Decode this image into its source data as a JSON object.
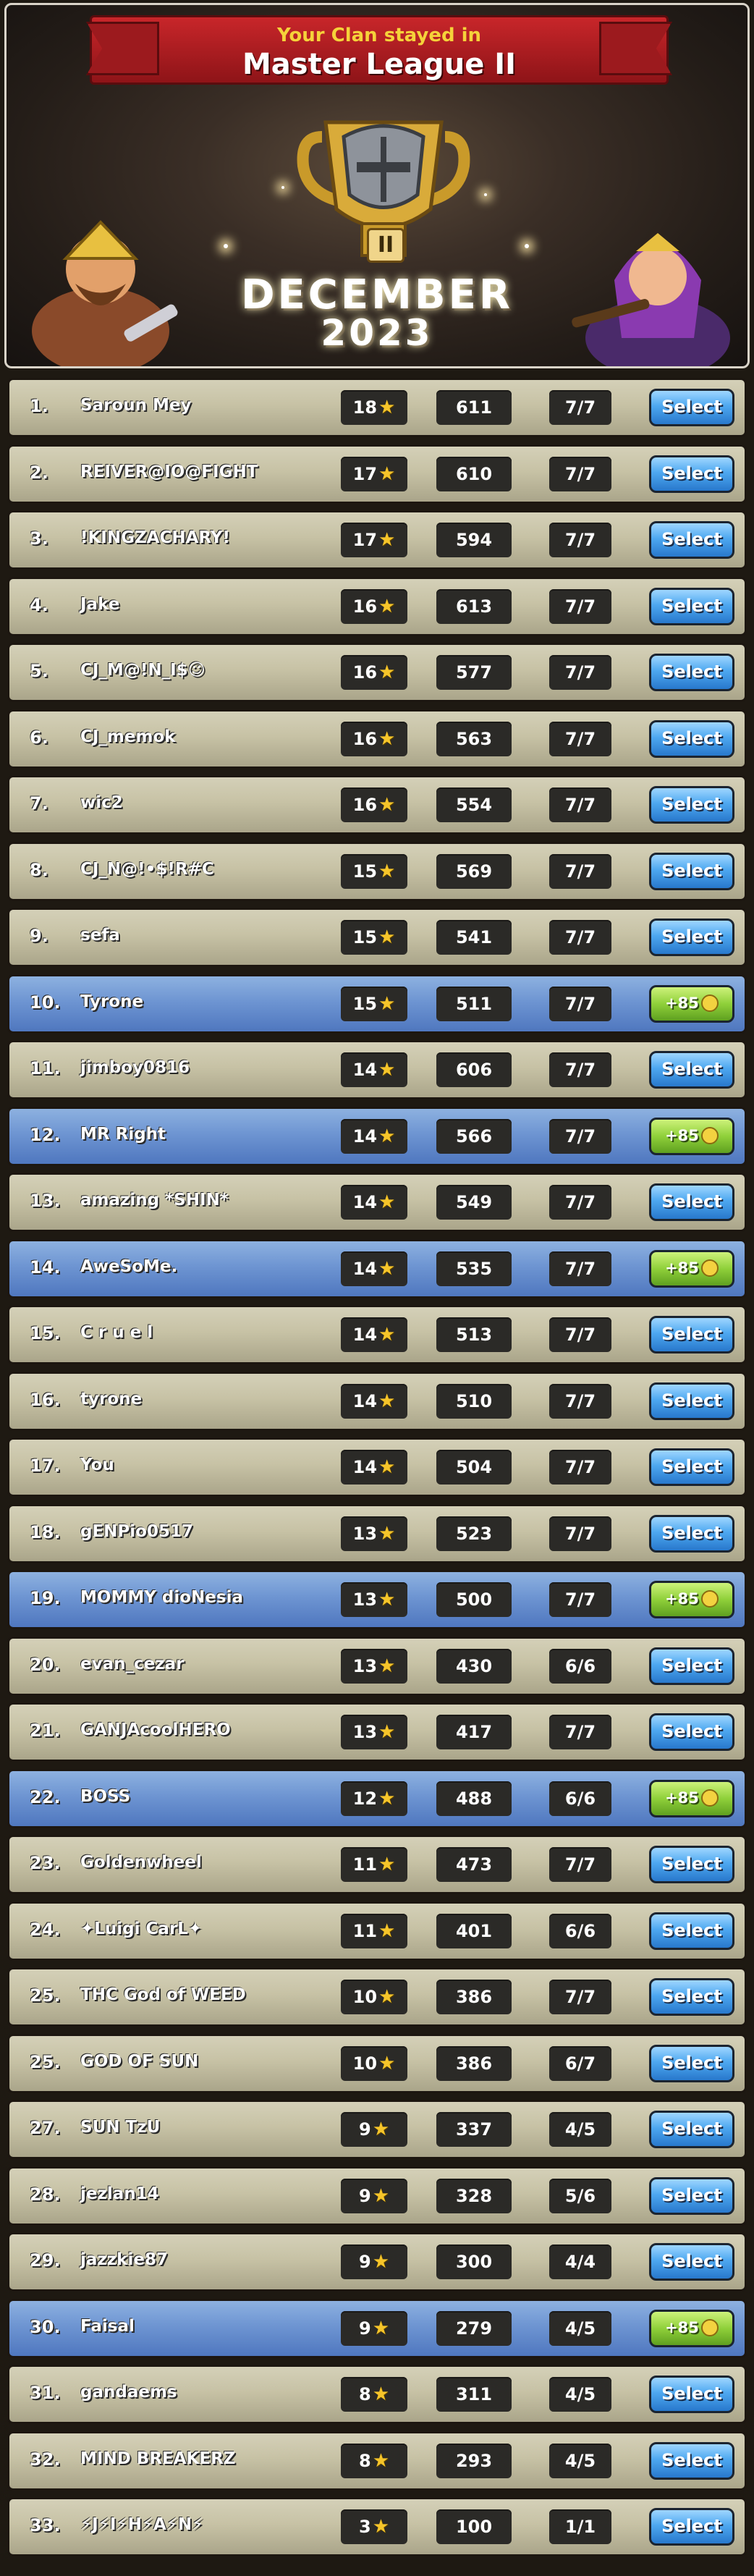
{
  "banner": {
    "subtitle": "Your Clan stayed in",
    "league": "Master League II",
    "league_badge": "II",
    "month": "DECEMBER",
    "year": "2023",
    "icons": [
      "trophy-icon",
      "barbarian-king-icon",
      "archer-queen-icon"
    ]
  },
  "colors": {
    "row_default": "#c7c2a5",
    "row_highlight": "#6e95d2",
    "select_button": "#4ea8f0",
    "bonus_button": "#8fd03a",
    "star": "#f6c52a"
  },
  "rows": [
    {
      "rank": "1.",
      "name": "Saroun Mey",
      "stars": "18",
      "score": "611",
      "attacks": "7/7",
      "action": "Select",
      "highlight": false
    },
    {
      "rank": "2.",
      "name": "REIVER@IO@FIGHT",
      "stars": "17",
      "score": "610",
      "attacks": "7/7",
      "action": "Select",
      "highlight": false
    },
    {
      "rank": "3.",
      "name": "!KINGZACHARY!",
      "stars": "17",
      "score": "594",
      "attacks": "7/7",
      "action": "Select",
      "highlight": false
    },
    {
      "rank": "4.",
      "name": "Jake",
      "stars": "16",
      "score": "613",
      "attacks": "7/7",
      "action": "Select",
      "highlight": false
    },
    {
      "rank": "5.",
      "name": "CJ_M@!N_I$☺",
      "stars": "16",
      "score": "577",
      "attacks": "7/7",
      "action": "Select",
      "highlight": false
    },
    {
      "rank": "6.",
      "name": "CJ_memok",
      "stars": "16",
      "score": "563",
      "attacks": "7/7",
      "action": "Select",
      "highlight": false
    },
    {
      "rank": "7.",
      "name": "wic2",
      "stars": "16",
      "score": "554",
      "attacks": "7/7",
      "action": "Select",
      "highlight": false
    },
    {
      "rank": "8.",
      "name": "CJ_N@!•$!R#C",
      "stars": "15",
      "score": "569",
      "attacks": "7/7",
      "action": "Select",
      "highlight": false
    },
    {
      "rank": "9.",
      "name": "sefa",
      "stars": "15",
      "score": "541",
      "attacks": "7/7",
      "action": "Select",
      "highlight": false
    },
    {
      "rank": "10.",
      "name": "Tyrone",
      "stars": "15",
      "score": "511",
      "attacks": "7/7",
      "action": "+85",
      "highlight": true
    },
    {
      "rank": "11.",
      "name": "jimboy0816",
      "stars": "14",
      "score": "606",
      "attacks": "7/7",
      "action": "Select",
      "highlight": false
    },
    {
      "rank": "12.",
      "name": "MR Right",
      "stars": "14",
      "score": "566",
      "attacks": "7/7",
      "action": "+85",
      "highlight": true
    },
    {
      "rank": "13.",
      "name": "amazing *SHIN*",
      "stars": "14",
      "score": "549",
      "attacks": "7/7",
      "action": "Select",
      "highlight": false
    },
    {
      "rank": "14.",
      "name": "AweSoMe.",
      "stars": "14",
      "score": "535",
      "attacks": "7/7",
      "action": "+85",
      "highlight": true
    },
    {
      "rank": "15.",
      "name": "C r u e l",
      "stars": "14",
      "score": "513",
      "attacks": "7/7",
      "action": "Select",
      "highlight": false
    },
    {
      "rank": "16.",
      "name": "tyrone",
      "stars": "14",
      "score": "510",
      "attacks": "7/7",
      "action": "Select",
      "highlight": false
    },
    {
      "rank": "17.",
      "name": "You",
      "stars": "14",
      "score": "504",
      "attacks": "7/7",
      "action": "Select",
      "highlight": false
    },
    {
      "rank": "18.",
      "name": "gENPio0517",
      "stars": "13",
      "score": "523",
      "attacks": "7/7",
      "action": "Select",
      "highlight": false
    },
    {
      "rank": "19.",
      "name": "MOMMY dioNesia",
      "stars": "13",
      "score": "500",
      "attacks": "7/7",
      "action": "+85",
      "highlight": true
    },
    {
      "rank": "20.",
      "name": "evan_cezar",
      "stars": "13",
      "score": "430",
      "attacks": "6/6",
      "action": "Select",
      "highlight": false
    },
    {
      "rank": "21.",
      "name": "GANJAcoolHERO",
      "stars": "13",
      "score": "417",
      "attacks": "7/7",
      "action": "Select",
      "highlight": false
    },
    {
      "rank": "22.",
      "name": "BOSS",
      "stars": "12",
      "score": "488",
      "attacks": "6/6",
      "action": "+85",
      "highlight": true
    },
    {
      "rank": "23.",
      "name": "Goldenwheel",
      "stars": "11",
      "score": "473",
      "attacks": "7/7",
      "action": "Select",
      "highlight": false
    },
    {
      "rank": "24.",
      "name": "✦Luigi CarL✦",
      "stars": "11",
      "score": "401",
      "attacks": "6/6",
      "action": "Select",
      "highlight": false
    },
    {
      "rank": "25.",
      "name": "THC God of WEED",
      "stars": "10",
      "score": "386",
      "attacks": "7/7",
      "action": "Select",
      "highlight": false
    },
    {
      "rank": "25.",
      "name": "GOD OF SUN",
      "stars": "10",
      "score": "386",
      "attacks": "6/7",
      "action": "Select",
      "highlight": false
    },
    {
      "rank": "27.",
      "name": "SUN TzU",
      "stars": "9",
      "score": "337",
      "attacks": "4/5",
      "action": "Select",
      "highlight": false
    },
    {
      "rank": "28.",
      "name": "jezlan14",
      "stars": "9",
      "score": "328",
      "attacks": "5/6",
      "action": "Select",
      "highlight": false
    },
    {
      "rank": "29.",
      "name": "jazzkie87",
      "stars": "9",
      "score": "300",
      "attacks": "4/4",
      "action": "Select",
      "highlight": false
    },
    {
      "rank": "30.",
      "name": "Faisal",
      "stars": "9",
      "score": "279",
      "attacks": "4/5",
      "action": "+85",
      "highlight": true
    },
    {
      "rank": "31.",
      "name": "gandaems",
      "stars": "8",
      "score": "311",
      "attacks": "4/5",
      "action": "Select",
      "highlight": false
    },
    {
      "rank": "32.",
      "name": "MIND BREAKERZ",
      "stars": "8",
      "score": "293",
      "attacks": "4/5",
      "action": "Select",
      "highlight": false
    },
    {
      "rank": "33.",
      "name": "⚡J⚡I⚡H⚡A⚡N⚡",
      "stars": "3",
      "score": "100",
      "attacks": "1/1",
      "action": "Select",
      "highlight": false
    }
  ]
}
